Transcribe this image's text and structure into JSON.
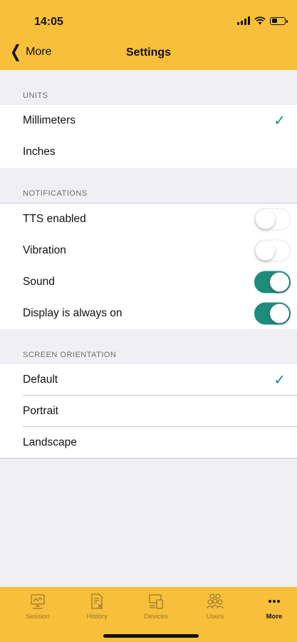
{
  "status": {
    "time": "14:05"
  },
  "nav": {
    "back_label": "More",
    "title": "Settings"
  },
  "sections": {
    "units": {
      "header": "UNITS",
      "items": [
        {
          "label": "Millimeters",
          "checked": true
        },
        {
          "label": "Inches",
          "checked": false
        }
      ]
    },
    "notifications": {
      "header": "NOTIFICATIONS",
      "items": [
        {
          "label": "TTS enabled",
          "on": false
        },
        {
          "label": "Vibration",
          "on": false
        },
        {
          "label": "Sound",
          "on": true
        },
        {
          "label": "Display is always on",
          "on": true
        }
      ]
    },
    "orientation": {
      "header": "SCREEN ORIENTATION",
      "items": [
        {
          "label": "Default",
          "checked": true
        },
        {
          "label": "Portrait",
          "checked": false
        },
        {
          "label": "Landscape",
          "checked": false
        }
      ]
    }
  },
  "check_glyph": "✓",
  "tabs": [
    {
      "label": "Session",
      "icon": "monitor-icon",
      "active": false
    },
    {
      "label": "History",
      "icon": "document-icon",
      "active": false
    },
    {
      "label": "Devices",
      "icon": "devices-icon",
      "active": false
    },
    {
      "label": "Users",
      "icon": "users-icon",
      "active": false
    },
    {
      "label": "More",
      "icon": "more-dots-icon",
      "active": true
    }
  ],
  "colors": {
    "header_bg": "#f7bf3a",
    "accent": "#1e8c7b",
    "page_bg": "#efeff4"
  }
}
